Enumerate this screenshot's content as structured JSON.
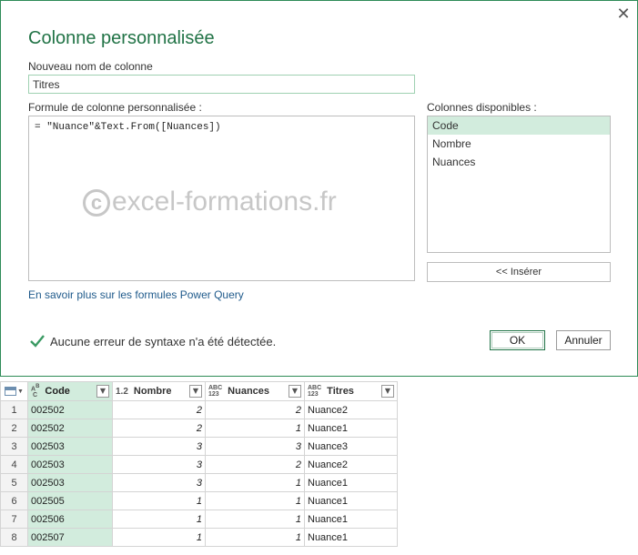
{
  "dialog": {
    "title": "Colonne personnalisée",
    "close_glyph": "✕",
    "name_label": "Nouveau nom de colonne",
    "name_value": "Titres",
    "formula_label": "Formule de colonne personnalisée :",
    "formula": "= \"Nuance\"&Text.From([Nuances])",
    "watermark_symbol": "c",
    "watermark_text": "excel-formations.fr",
    "available_label": "Colonnes disponibles :",
    "available": [
      {
        "label": "Code",
        "selected": true
      },
      {
        "label": "Nombre",
        "selected": false
      },
      {
        "label": "Nuances",
        "selected": false
      }
    ],
    "insert_label": "<< Insérer",
    "learn_link": "En savoir plus sur les formules Power Query",
    "status": "Aucune erreur de syntaxe n'a été détectée.",
    "ok_label": "OK",
    "cancel_label": "Annuler",
    "accent_color": "#217346"
  },
  "table": {
    "columns": [
      {
        "type": "ABC",
        "name": "Code"
      },
      {
        "type": "1.2",
        "name": "Nombre"
      },
      {
        "type": "ABC123",
        "name": "Nuances"
      },
      {
        "type": "ABC123",
        "name": "Titres"
      }
    ],
    "dropdown_glyph": "▼",
    "rows": [
      [
        "1",
        "002502",
        "2",
        "2",
        "Nuance2"
      ],
      [
        "2",
        "002502",
        "2",
        "1",
        "Nuance1"
      ],
      [
        "3",
        "002503",
        "3",
        "3",
        "Nuance3"
      ],
      [
        "4",
        "002503",
        "3",
        "2",
        "Nuance2"
      ],
      [
        "5",
        "002503",
        "3",
        "1",
        "Nuance1"
      ],
      [
        "6",
        "002505",
        "1",
        "1",
        "Nuance1"
      ],
      [
        "7",
        "002506",
        "1",
        "1",
        "Nuance1"
      ],
      [
        "8",
        "002507",
        "1",
        "1",
        "Nuance1"
      ]
    ]
  }
}
